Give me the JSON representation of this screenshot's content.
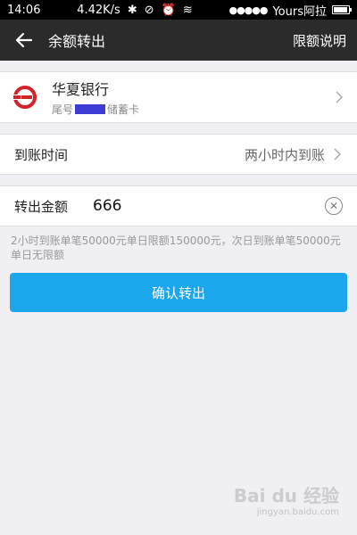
{
  "status_bar": {
    "time": "14:06",
    "speed": "4.42K/s",
    "signal_dots": "●●●●●",
    "carrier": "Yours阿拉"
  },
  "nav": {
    "title": "余额转出",
    "right_action": "限额说明"
  },
  "bank": {
    "name": "华夏银行",
    "tail_prefix": "尾号",
    "card_type": "储蓄卡"
  },
  "arrival": {
    "label": "到账时间",
    "value": "两小时内到账"
  },
  "amount": {
    "label": "转出金额",
    "value": "666"
  },
  "hint": "2小时到账单笔50000元单日限额150000元，次日到账单笔50000元单日无限额",
  "confirm_label": "确认转出",
  "watermark": {
    "brand": "Bai du 经验",
    "url": "jingyan.baidu.com"
  },
  "colors": {
    "accent": "#1ca6ec",
    "bank_red": "#d4222a",
    "nav_bg": "#2b2b2b"
  }
}
